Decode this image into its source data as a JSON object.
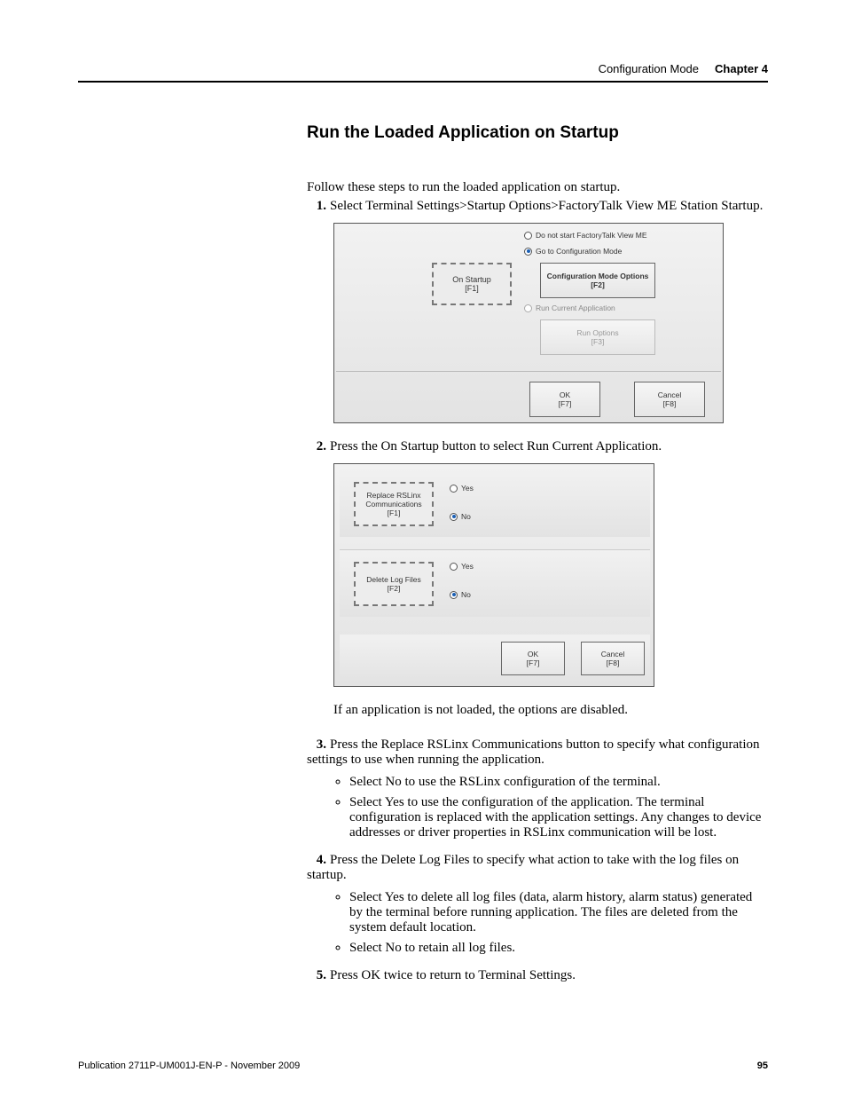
{
  "header": {
    "section": "Configuration Mode",
    "chapter": "Chapter 4"
  },
  "title": "Run the Loaded Application on Startup",
  "intro": "Follow these steps to run the loaded application on startup.",
  "steps": [
    {
      "num": "1.",
      "text": "Select Terminal Settings>Startup Options>FactoryTalk View ME Station Startup."
    },
    {
      "num": "2.",
      "text": "Press the On Startup button to select Run Current Application."
    },
    {
      "num": "3.",
      "text": "Press the Replace RSLinx Communications button to specify what configuration settings to use when running the application."
    },
    {
      "num": "4.",
      "text": "Press the Delete Log Files to specify what action to take with the log files on startup."
    },
    {
      "num": "5.",
      "text": "Press OK twice to return to Terminal Settings."
    }
  ],
  "note_after_fig2": "If an application is not loaded, the options are disabled.",
  "bullets_step3": [
    "Select No to use the RSLinx configuration of the terminal.",
    "Select Yes to use the configuration of the application. The terminal configuration is replaced with the application settings. Any changes to device addresses or driver properties in RSLinx communication will be lost."
  ],
  "bullets_step4": [
    "Select Yes to delete all log files (data, alarm history, alarm status) generated by the terminal before running application. The files are deleted from the system default location.",
    "Select No to retain all log files."
  ],
  "fig1": {
    "on_startup_label": "On Startup",
    "on_startup_key": "[F1]",
    "radio_none": "Do not start FactoryTalk View ME",
    "radio_config": "Go to Configuration Mode",
    "radio_run": "Run Current Application",
    "btn_config_label": "Configuration Mode Options",
    "btn_config_key": "[F2]",
    "btn_run_label": "Run Options",
    "btn_run_key": "[F3]",
    "ok_label": "OK",
    "ok_key": "[F7]",
    "cancel_label": "Cancel",
    "cancel_key": "[F8]"
  },
  "fig2": {
    "replace_label": "Replace RSLinx Communications",
    "replace_key": "[F1]",
    "delete_label": "Delete Log Files",
    "delete_key": "[F2]",
    "yes": "Yes",
    "no": "No",
    "ok_label": "OK",
    "ok_key": "[F7]",
    "cancel_label": "Cancel",
    "cancel_key": "[F8]"
  },
  "footer": {
    "pub": "Publication 2711P-UM001J-EN-P - November 2009",
    "page": "95"
  }
}
